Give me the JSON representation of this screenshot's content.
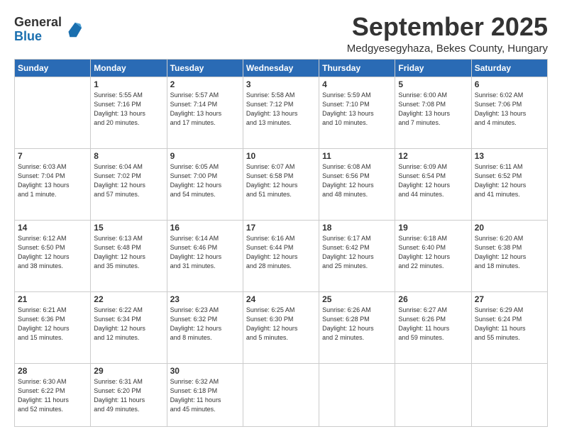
{
  "logo": {
    "general": "General",
    "blue": "Blue"
  },
  "header": {
    "month": "September 2025",
    "location": "Medgyesegyhaza, Bekes County, Hungary"
  },
  "weekdays": [
    "Sunday",
    "Monday",
    "Tuesday",
    "Wednesday",
    "Thursday",
    "Friday",
    "Saturday"
  ],
  "weeks": [
    [
      {
        "day": "",
        "info": ""
      },
      {
        "day": "1",
        "info": "Sunrise: 5:55 AM\nSunset: 7:16 PM\nDaylight: 13 hours\nand 20 minutes."
      },
      {
        "day": "2",
        "info": "Sunrise: 5:57 AM\nSunset: 7:14 PM\nDaylight: 13 hours\nand 17 minutes."
      },
      {
        "day": "3",
        "info": "Sunrise: 5:58 AM\nSunset: 7:12 PM\nDaylight: 13 hours\nand 13 minutes."
      },
      {
        "day": "4",
        "info": "Sunrise: 5:59 AM\nSunset: 7:10 PM\nDaylight: 13 hours\nand 10 minutes."
      },
      {
        "day": "5",
        "info": "Sunrise: 6:00 AM\nSunset: 7:08 PM\nDaylight: 13 hours\nand 7 minutes."
      },
      {
        "day": "6",
        "info": "Sunrise: 6:02 AM\nSunset: 7:06 PM\nDaylight: 13 hours\nand 4 minutes."
      }
    ],
    [
      {
        "day": "7",
        "info": "Sunrise: 6:03 AM\nSunset: 7:04 PM\nDaylight: 13 hours\nand 1 minute."
      },
      {
        "day": "8",
        "info": "Sunrise: 6:04 AM\nSunset: 7:02 PM\nDaylight: 12 hours\nand 57 minutes."
      },
      {
        "day": "9",
        "info": "Sunrise: 6:05 AM\nSunset: 7:00 PM\nDaylight: 12 hours\nand 54 minutes."
      },
      {
        "day": "10",
        "info": "Sunrise: 6:07 AM\nSunset: 6:58 PM\nDaylight: 12 hours\nand 51 minutes."
      },
      {
        "day": "11",
        "info": "Sunrise: 6:08 AM\nSunset: 6:56 PM\nDaylight: 12 hours\nand 48 minutes."
      },
      {
        "day": "12",
        "info": "Sunrise: 6:09 AM\nSunset: 6:54 PM\nDaylight: 12 hours\nand 44 minutes."
      },
      {
        "day": "13",
        "info": "Sunrise: 6:11 AM\nSunset: 6:52 PM\nDaylight: 12 hours\nand 41 minutes."
      }
    ],
    [
      {
        "day": "14",
        "info": "Sunrise: 6:12 AM\nSunset: 6:50 PM\nDaylight: 12 hours\nand 38 minutes."
      },
      {
        "day": "15",
        "info": "Sunrise: 6:13 AM\nSunset: 6:48 PM\nDaylight: 12 hours\nand 35 minutes."
      },
      {
        "day": "16",
        "info": "Sunrise: 6:14 AM\nSunset: 6:46 PM\nDaylight: 12 hours\nand 31 minutes."
      },
      {
        "day": "17",
        "info": "Sunrise: 6:16 AM\nSunset: 6:44 PM\nDaylight: 12 hours\nand 28 minutes."
      },
      {
        "day": "18",
        "info": "Sunrise: 6:17 AM\nSunset: 6:42 PM\nDaylight: 12 hours\nand 25 minutes."
      },
      {
        "day": "19",
        "info": "Sunrise: 6:18 AM\nSunset: 6:40 PM\nDaylight: 12 hours\nand 22 minutes."
      },
      {
        "day": "20",
        "info": "Sunrise: 6:20 AM\nSunset: 6:38 PM\nDaylight: 12 hours\nand 18 minutes."
      }
    ],
    [
      {
        "day": "21",
        "info": "Sunrise: 6:21 AM\nSunset: 6:36 PM\nDaylight: 12 hours\nand 15 minutes."
      },
      {
        "day": "22",
        "info": "Sunrise: 6:22 AM\nSunset: 6:34 PM\nDaylight: 12 hours\nand 12 minutes."
      },
      {
        "day": "23",
        "info": "Sunrise: 6:23 AM\nSunset: 6:32 PM\nDaylight: 12 hours\nand 8 minutes."
      },
      {
        "day": "24",
        "info": "Sunrise: 6:25 AM\nSunset: 6:30 PM\nDaylight: 12 hours\nand 5 minutes."
      },
      {
        "day": "25",
        "info": "Sunrise: 6:26 AM\nSunset: 6:28 PM\nDaylight: 12 hours\nand 2 minutes."
      },
      {
        "day": "26",
        "info": "Sunrise: 6:27 AM\nSunset: 6:26 PM\nDaylight: 11 hours\nand 59 minutes."
      },
      {
        "day": "27",
        "info": "Sunrise: 6:29 AM\nSunset: 6:24 PM\nDaylight: 11 hours\nand 55 minutes."
      }
    ],
    [
      {
        "day": "28",
        "info": "Sunrise: 6:30 AM\nSunset: 6:22 PM\nDaylight: 11 hours\nand 52 minutes."
      },
      {
        "day": "29",
        "info": "Sunrise: 6:31 AM\nSunset: 6:20 PM\nDaylight: 11 hours\nand 49 minutes."
      },
      {
        "day": "30",
        "info": "Sunrise: 6:32 AM\nSunset: 6:18 PM\nDaylight: 11 hours\nand 45 minutes."
      },
      {
        "day": "",
        "info": ""
      },
      {
        "day": "",
        "info": ""
      },
      {
        "day": "",
        "info": ""
      },
      {
        "day": "",
        "info": ""
      }
    ]
  ]
}
